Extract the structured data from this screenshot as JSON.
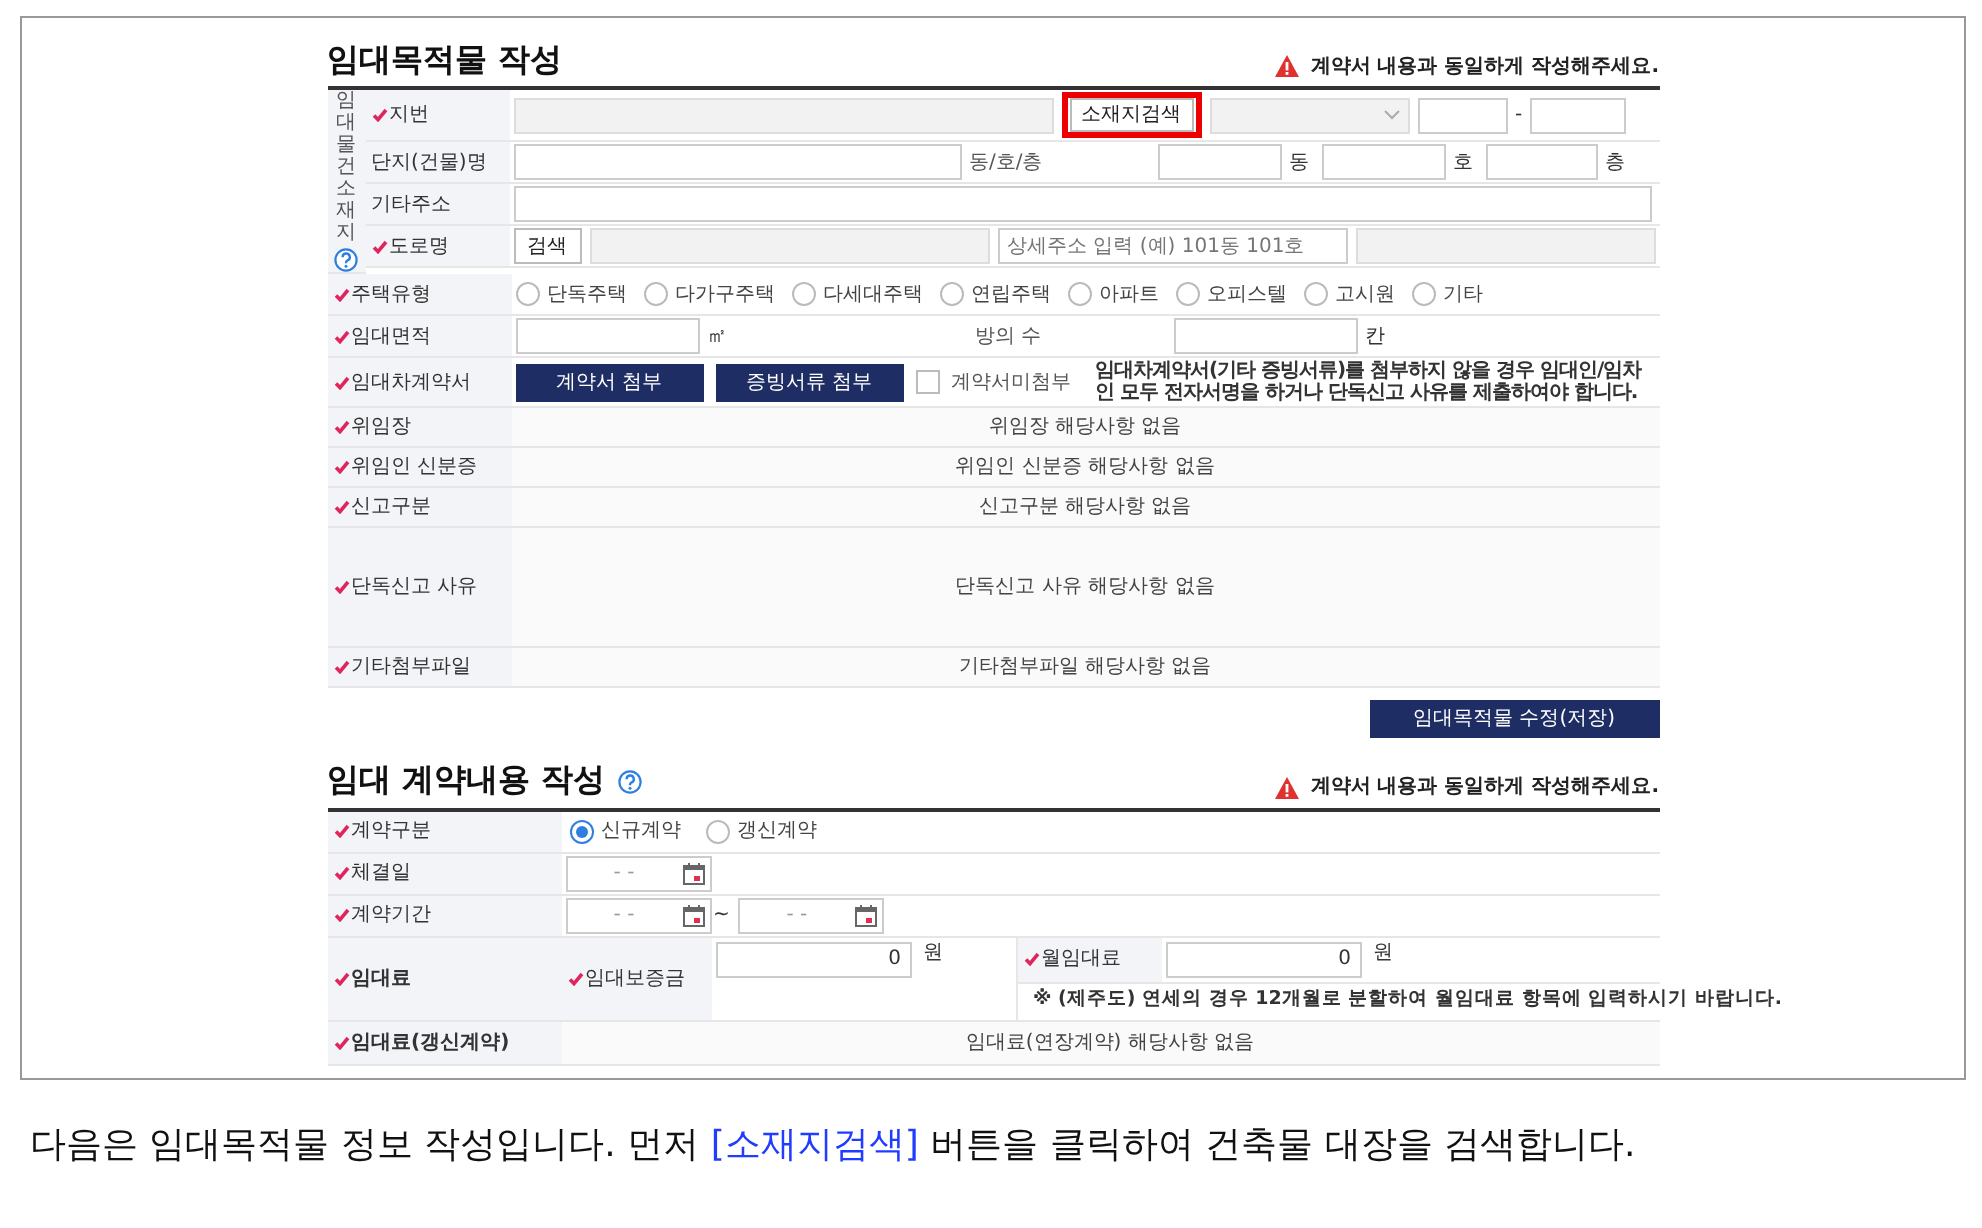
{
  "section1": {
    "title": "임대목적물 작성",
    "notice": "계약서 내용과 동일하게 작성해주세요.",
    "address_group": {
      "label": "임대물건소재지",
      "lot": {
        "label": "지번",
        "required": true,
        "search_button": {
          "label": "소재지검색",
          "highlighted": true
        },
        "separator": "-"
      },
      "complex": {
        "label": "단지(건물)명",
        "required": false,
        "unit_label": "동/호/층",
        "units": [
          "동",
          "호",
          "층"
        ]
      },
      "other": {
        "label": "기타주소",
        "required": false
      },
      "road": {
        "label": "도로명",
        "required": true,
        "search_button": "검색",
        "detail_placeholder": "상세주소 입력 (예) 101동 101호"
      }
    },
    "housing_type": {
      "label": "주택유형",
      "required": true,
      "options": [
        {
          "label": "단독주택",
          "selected": false
        },
        {
          "label": "다가구주택",
          "selected": false
        },
        {
          "label": "다세대주택",
          "selected": false
        },
        {
          "label": "연립주택",
          "selected": false
        },
        {
          "label": "아파트",
          "selected": false
        },
        {
          "label": "오피스텔",
          "selected": false
        },
        {
          "label": "고시원",
          "selected": false
        },
        {
          "label": "기타",
          "selected": false
        }
      ]
    },
    "area": {
      "label": "임대면적",
      "required": true,
      "unit": "㎡",
      "rooms_label": "방의 수",
      "rooms_unit": "칸"
    },
    "contract_doc": {
      "label": "임대차계약서",
      "required": true,
      "buttons": [
        "계약서 첨부",
        "증빙서류 첨부"
      ],
      "checkbox": {
        "label": "계약서미첨부",
        "checked": false
      },
      "note": "임대차계약서(기타 증빙서류)를 첨부하지 않을 경우 임대인/임차인 모두 전자서명을 하거나 단독신고 사유를 제출하여야 합니다."
    },
    "info_rows": [
      {
        "kind": "single",
        "label": "위임장",
        "required": true,
        "text": "위임장 해당사항 없음"
      },
      {
        "kind": "single",
        "label": "위임인 신분증",
        "required": true,
        "text": "위임인 신분증 해당사항 없음"
      },
      {
        "kind": "single",
        "label": "신고구분",
        "required": true,
        "text": "신고구분 해당사항 없음"
      },
      {
        "kind": "multiline",
        "label": "단독신고 사유",
        "required": true,
        "text": "단독신고 사유 해당사항 없음"
      },
      {
        "kind": "single",
        "label": "기타첨부파일",
        "required": true,
        "text": "기타첨부파일 해당사항 없음"
      }
    ],
    "save_button": "임대목적물 수정(저장)"
  },
  "section2": {
    "title": "임대 계약내용 작성",
    "notice": "계약서 내용과 동일하게 작성해주세요.",
    "contract_type": {
      "label": "계약구분",
      "required": true,
      "options": [
        {
          "label": "신규계약",
          "selected": true
        },
        {
          "label": "갱신계약",
          "selected": false
        }
      ]
    },
    "signed_date": {
      "label": "체결일",
      "required": true,
      "placeholder": "- -"
    },
    "period": {
      "label": "계약기간",
      "required": true,
      "start_placeholder": "- -",
      "separator": "~",
      "end_placeholder": "- -"
    },
    "rent": {
      "label": "임대료",
      "required": true,
      "deposit": {
        "label": "임대보증금",
        "required": true,
        "value": "0",
        "unit": "원"
      },
      "monthly": {
        "label": "월임대료",
        "required": true,
        "value": "0",
        "unit": "원"
      },
      "note": "※ (제주도) 연세의 경우 12개월로 분할하여 월임대료 항목에 입력하시기 바랍니다."
    },
    "renewal_rent": {
      "label": "임대료(갱신계약)",
      "required": true,
      "text": "임대료(연장계약) 해당사항 없음"
    }
  },
  "caption": {
    "parts": [
      {
        "text": "다음은 임대목적물 정보 작성입니다. 먼저 ",
        "highlight": false
      },
      {
        "text": "[소재지검색]",
        "highlight": true
      },
      {
        "text": " 버튼을 클릭하여 건축물 대장을 검색합니다.",
        "highlight": false
      }
    ]
  }
}
